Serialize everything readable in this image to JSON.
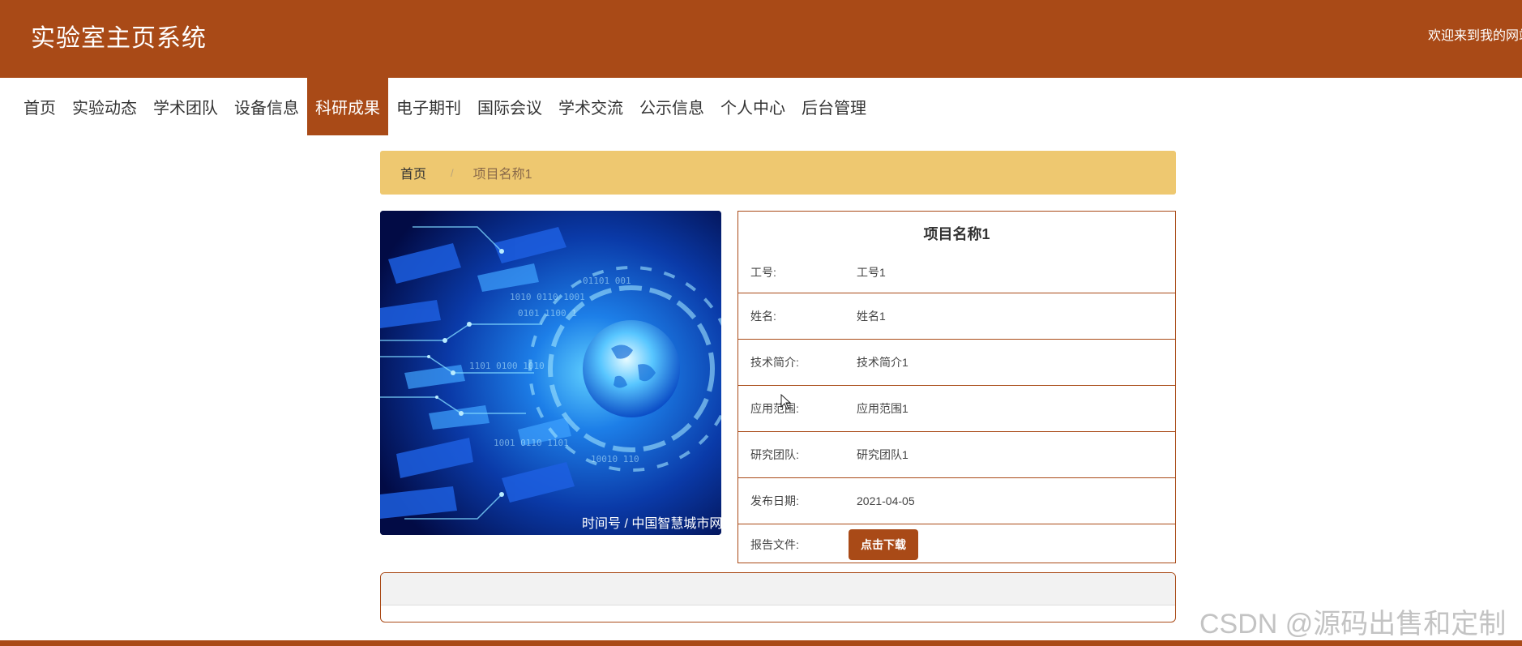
{
  "header": {
    "site_title": "实验室主页系统",
    "welcome": "欢迎来到我的网站"
  },
  "nav": {
    "items": [
      {
        "label": "首页"
      },
      {
        "label": "实验动态"
      },
      {
        "label": "学术团队"
      },
      {
        "label": "设备信息"
      },
      {
        "label": "科研成果",
        "active": true
      },
      {
        "label": "电子期刊"
      },
      {
        "label": "国际会议"
      },
      {
        "label": "学术交流"
      },
      {
        "label": "公示信息"
      },
      {
        "label": "个人中心"
      },
      {
        "label": "后台管理"
      }
    ]
  },
  "breadcrumb": {
    "home": "首页",
    "separator": "/",
    "current": "项目名称1"
  },
  "image": {
    "caption": "时间号 / 中国智慧城市网"
  },
  "detail": {
    "title": "项目名称1",
    "rows": [
      {
        "label": "工号:",
        "value": "工号1"
      },
      {
        "label": "姓名:",
        "value": "姓名1"
      },
      {
        "label": "技术简介:",
        "value": "技术简介1"
      },
      {
        "label": "应用范围:",
        "value": "应用范围1"
      },
      {
        "label": "研究团队:",
        "value": "研究团队1"
      },
      {
        "label": "发布日期:",
        "value": "2021-04-05"
      }
    ],
    "report_label": "报告文件:",
    "download_label": "点击下载"
  },
  "watermark": "CSDN @源码出售和定制",
  "colors": {
    "primary": "#a94a17",
    "breadcrumb_bg": "#eec870",
    "white": "#ffffff"
  }
}
